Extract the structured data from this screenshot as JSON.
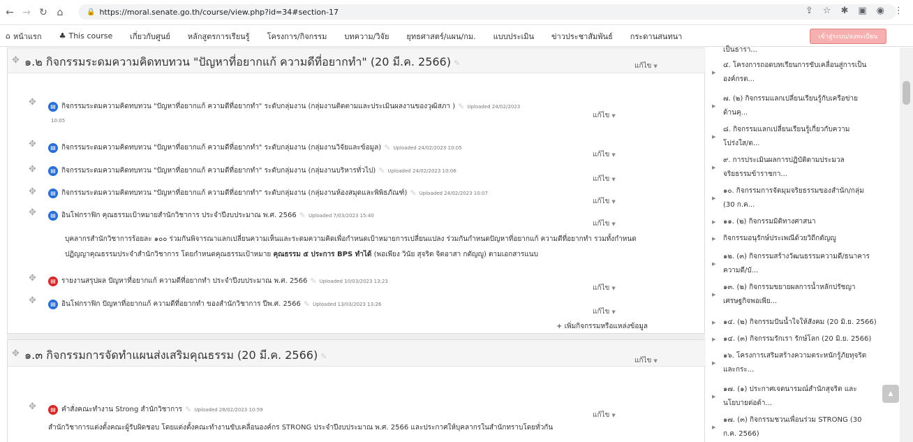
{
  "browser": {
    "url": "https://moral.senate.go.th/course/view.php?id=34#section-17"
  },
  "nav": {
    "items": [
      "หน้าแรก",
      "This course",
      "เกี่ยวกับศูนย์",
      "หลักสูตรการเรียนรู้",
      "โครงการ/กิจกรรม",
      "บทความ/วิจัย",
      "ยุทธศาสตร์/แผน/กม.",
      "แบบประเมิน",
      "ข่าวประชาสัมพันธ์",
      "กระดานสนทนา"
    ],
    "login_label": "เข้าสู่ระบบ/ลงทะเบียน"
  },
  "section1": {
    "title": "๑.๒ กิจกรรมระดมความคิดทบทวน \"ปัญหาที่อยากแก้ ความดีที่อยากทำ\" (20 มี.ค. 2566)",
    "edit": "แก้ไข",
    "activities": [
      {
        "name": "กิจกรรมระดมความคิดทบทวน \"ปัญหาที่อยากแก้ ความดีที่อยากทำ\" ระดับกลุ่มงาน (กลุ่มงานติดตามและประเมินผลงานของวุฒิสภา )",
        "uploaded": "Uploaded 24/02/2023",
        "time": "10:05",
        "edit": "แก้ไข"
      },
      {
        "name": "กิจกรรมระดมความคิดทบทวน \"ปัญหาที่อยากแก้ ความดีที่อยากทำ\" ระดับกลุ่มงาน (กลุ่มงานวิจัยและข้อมูล)",
        "uploaded": "Uploaded 24/02/2023 10:05",
        "edit": "แก้ไข"
      },
      {
        "name": "กิจกรรมระดมความคิดทบทวน \"ปัญหาที่อยากแก้ ความดีที่อยากทำ\" ระดับกลุ่มงาน (กลุ่มงานบริหารทั่วไป)",
        "uploaded": "Uploaded 24/02/2023 10:06",
        "edit": "แก้ไข"
      },
      {
        "name": "กิจกรรมระดมความคิดทบทวน \"ปัญหาที่อยากแก้ ความดีที่อยากทำ\" ระดับกลุ่มงาน (กลุ่มงานห้องสมุดและพิพิธภัณฑ์)",
        "uploaded": "Uploaded 24/02/2023 10:07",
        "edit": "แก้ไข"
      },
      {
        "name": "อินโฟกราฟิก คุณธรรมเป้าหมายสำนักวิชาการ ประจำปีงบประมาณ พ.ศ. 2566",
        "uploaded": "Uploaded 7/03/2023 15:40",
        "edit": "แก้ไข"
      }
    ],
    "desc_line1": "บุคลากรสำนักวิชาการร้อยละ ๑๐๐ ร่วมกันพิจารณาแลกเปลี่ยนความเห็นและระดมความคิดเพื่อกำหนดเป้าหมายการเปลี่ยนแปลง ร่วมกันกำหนดปัญหาที่อยากแก้ ความดีที่อยากทำ รวมทั้งกำหนด",
    "desc_line2_a": "ปฏิญญาคุณธรรมประจำสำนักวิชาการ โดยกำหนดคุณธรรมเป้าหมาย ",
    "desc_line2_b": "คุณธรรม ๕ ประการ BPS ทำได้",
    "desc_line2_c": " (พอเพียง วินัย สุจริต จิตอาสา กตัญญู) ตามเอกสารแนบ",
    "activities2": [
      {
        "name": "รายงานสรุปผล ปัญหาที่อยากแก้ ความดีที่อยากทำ ประจำปีงบประมาณ พ.ศ. 2566",
        "uploaded": "Uploaded 10/03/2023 13:23",
        "edit": "แก้ไข"
      },
      {
        "name": "อินโฟกราฟิก ปัญหาที่อยากแก้ ความดีที่อยากทำ ของสำนักวิชาการ ปีพ.ศ. 2566",
        "uploaded": "Uploaded 13/03/2023 13:26",
        "edit": "แก้ไข"
      }
    ],
    "add_label": "เพิ่มกิจกรรมหรือแหล่งข้อมูล"
  },
  "section2": {
    "title": "๑.๓ กิจกรรมการจัดทำแผนส่งเสริมคุณธรรม (20 มี.ค. 2566)",
    "edit": "แก้ไข",
    "activity": {
      "name": "คำสั่งคณะทำงาน Strong สำนักวิชาการ",
      "uploaded": "Uploaded 28/02/2023 10:59",
      "edit": "แก้ไข"
    },
    "desc": "สำนักวิชาการแต่งตั้งคณะผู้รับผิดชอบ โดยแต่งตั้งคณะทำงานขับเคลื่อนองค์กร STRONG ประจำปีงบประมาณ พ.ศ. 2566 และประกาศให้บุคลากรในสำนักทราบโดยทั่วกัน"
  },
  "right": {
    "items": [
      {
        "l1": "เป็นธารา..."
      },
      {
        "l1": "๔. โครงการถอดบทเรียนการขับเคลื่อนสู่การเป็น",
        "l2": "องค์กรต..."
      },
      {
        "l1": "๗. (๒) กิจกรรมแลกเปลี่ยนเรียนรู้กับเครือข่าย",
        "l2": "ด้านคุ..."
      },
      {
        "l1": "๘. กิจกรรมแลกเปลี่ยนเรียนรู้เกี่ยวกับความ",
        "l2": "โปร่งใส/ต..."
      },
      {
        "l1": "๙. การประเมินผลการปฏิบัติตามประมวล",
        "l2": "จริยธรรมข้าราชกา..."
      },
      {
        "l1": "๑๐. กิจกรรมการจัดมุมจริยธรรมของสำนัก/กลุ่ม",
        "l2": "(30 ก.ค..."
      },
      {
        "l1": "๑๑. (๒) กิจกรรมมิติทางศาสนา"
      },
      {
        "l1": "กิจกรรมอนุรักษ์ประเพณีด้วยวิถีกตัญญู"
      },
      {
        "l1": "๑๒. (๓) กิจกรรมสร้างวัฒนธรรมความดี/ธนาคาร",
        "l2": "ความดี/บั..."
      },
      {
        "l1": "๑๓. (๒) กิจกรรมขยายผลการน้ำหลักปรัชญา",
        "l2": "เศรษฐกิจพอเพีย..."
      },
      {
        "l1": "๑๔. (๒) กิจกรรมปันน้ำใจให้สังคม (20 มิ.ย. 2566)"
      },
      {
        "l1": "๑๔. (๓) กิจกรรมรักเรา รักษ์โลก (20 มิ.ย. 2566)"
      },
      {
        "l1": "๑๖. โครงการเสริมสร้างความตระหนักรู้ภัยทุจริต",
        "l2": "และกระ..."
      },
      {
        "l1": "๑๗. (๑) ประกาศเจตนารมณ์สำนักสุจริต และ",
        "l2": "นโยบายต่อต้า..."
      },
      {
        "l1": "๑๗. (๓) กิจกรรมชวนเพื่อนร่วม STRONG (30",
        "l2": "ก.ค. 2566)"
      }
    ]
  }
}
